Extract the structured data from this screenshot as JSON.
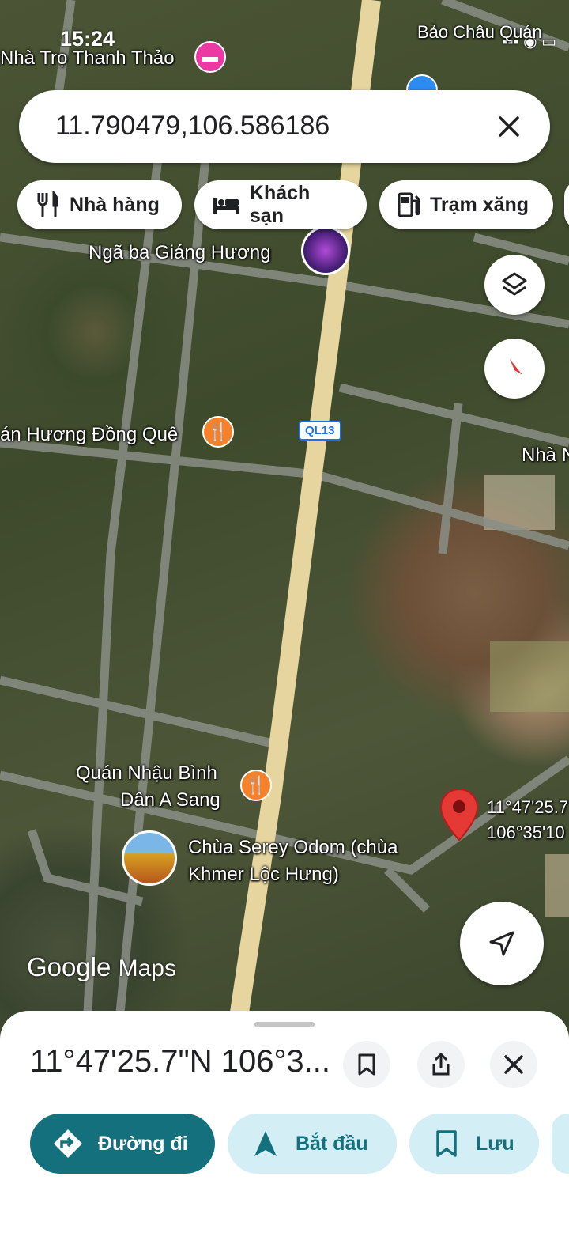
{
  "status_bar": {
    "time": "15:24"
  },
  "search": {
    "query": "11.790479,106.586186"
  },
  "chips": [
    {
      "label": "Nhà hàng",
      "icon": "fork-knife-icon"
    },
    {
      "label": "Khách sạn",
      "icon": "bed-icon"
    },
    {
      "label": "Trạm xăng",
      "icon": "gas-station-icon"
    }
  ],
  "map": {
    "labels": {
      "top_right": "Bảo Châu Quán",
      "nha_tro": "Nhà Trọ Thanh Thảo",
      "nga_ba": "Ngã ba Giáng Hương",
      "quan_huong": "án Hương Đồng Quê",
      "nha_right": "Nhà N",
      "road_sign": "QL13",
      "quan_nhau_1": "Quán Nhậu Bình",
      "quan_nhau_2": "Dân A Sang",
      "chua_1": "Chùa Serey Odom (chùa",
      "chua_2": "Khmer Lộc Hưng)",
      "pin_lat": "11°47'25.7",
      "pin_lng": "106°35'10"
    },
    "logo": {
      "google": "Google",
      "maps": "Maps"
    }
  },
  "sheet": {
    "title": "11°47'25.7\"N 106°3...",
    "actions": [
      {
        "label": "Đường đi",
        "icon": "directions-icon",
        "style": "primary"
      },
      {
        "label": "Bắt đầu",
        "icon": "navigation-arrow-icon",
        "style": "secondary"
      },
      {
        "label": "Lưu",
        "icon": "bookmark-icon",
        "style": "secondary"
      }
    ]
  },
  "colors": {
    "accent": "#0b7285",
    "primary_button": "#14707d",
    "secondary_button": "#d3eef5",
    "pin_red": "#e53935"
  }
}
